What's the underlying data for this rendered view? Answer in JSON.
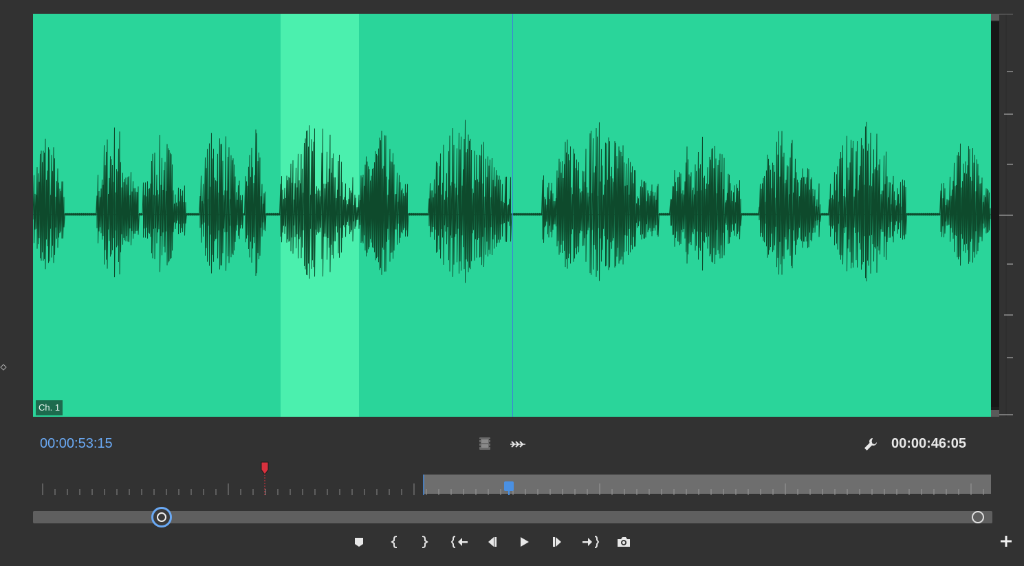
{
  "monitor": {
    "channel_label": "Ch. 1",
    "playhead_timecode": "00:00:53:15",
    "duration_timecode": "00:00:46:05"
  },
  "colors": {
    "waveform_bg": "#2ad59a",
    "selection": "#4bf0ae",
    "waveform": "#0e4a2c",
    "timecode_accent": "#6aa9f4",
    "marker": "#d8313e"
  },
  "toolbar": {
    "drag_video_icon": "film-strip-icon",
    "drag_audio_icon": "audio-waveform-icon",
    "settings_icon": "wrench-icon"
  },
  "transport": {
    "buttons": [
      "add-marker-icon",
      "mark-in-icon",
      "mark-out-icon",
      "go-to-in-icon",
      "step-back-icon",
      "play-icon",
      "step-forward-icon",
      "go-to-out-icon",
      "export-frame-icon"
    ],
    "add_button": "plus-icon"
  }
}
